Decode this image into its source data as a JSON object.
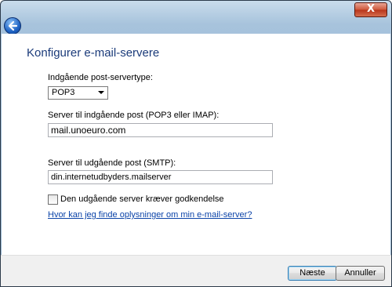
{
  "window": {
    "close_glyph": "X"
  },
  "nav": {
    "back_icon": "back-arrow-icon"
  },
  "page": {
    "title": "Konfigurer e-mail-servere"
  },
  "incoming_type": {
    "label": "Indgående post-servertype:",
    "value": "POP3"
  },
  "incoming_server": {
    "label": "Server til indgående post (POP3 eller IMAP):",
    "value": "mail.unoeuro.com"
  },
  "outgoing_server": {
    "label": "Server til udgående post (SMTP):",
    "value": "din.internetudbyders.mailserver"
  },
  "auth_checkbox": {
    "label": "Den udgående server kræver godkendelse",
    "checked": false
  },
  "help_link": {
    "text": "Hvor kan jeg finde oplysninger om min e-mail-server?"
  },
  "footer": {
    "next_label": "Næste",
    "cancel_label": "Annuller"
  }
}
